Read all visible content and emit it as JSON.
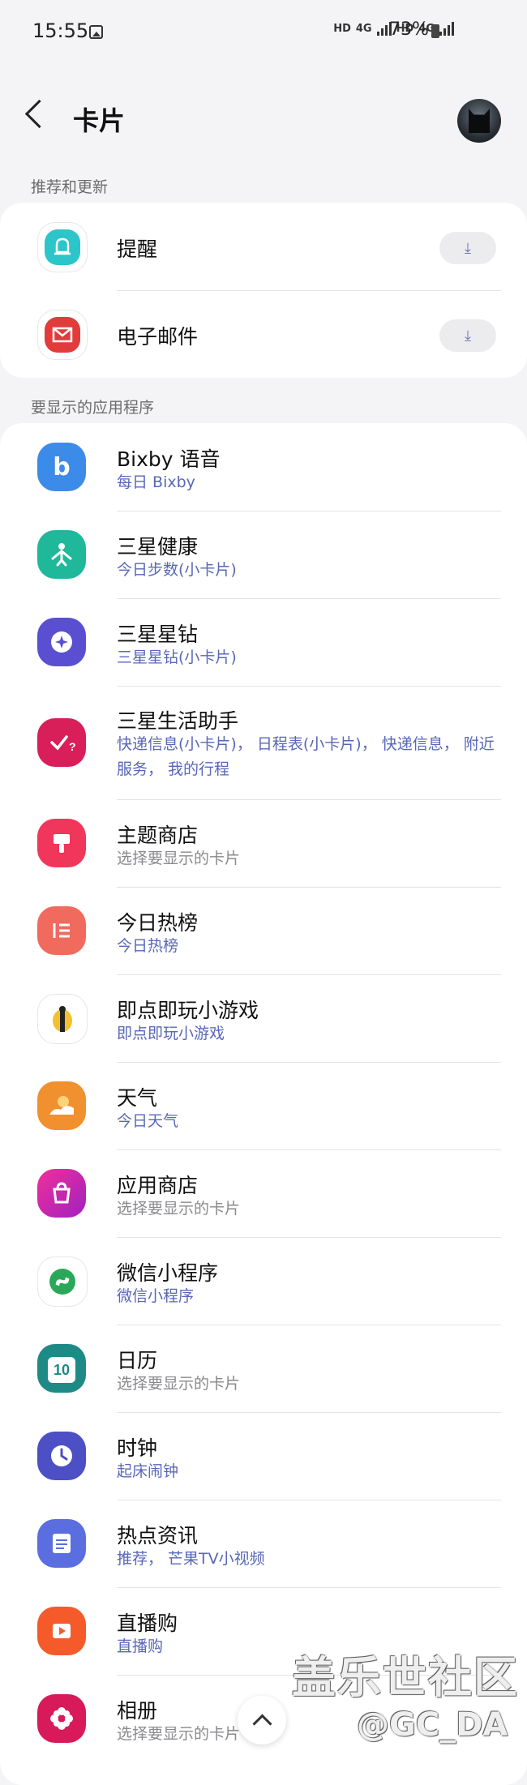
{
  "status_bar": {
    "time": "15:55",
    "net1": "HD",
    "net2": "4G",
    "net3": "HD",
    "net4": "4G",
    "battery": "73%"
  },
  "header": {
    "title": "卡片"
  },
  "recommended": {
    "label": "推荐和更新",
    "items": [
      {
        "name": "提醒",
        "icon": "reminder-bell-icon",
        "color": "#2cc5c9"
      },
      {
        "name": "电子邮件",
        "icon": "mail-icon",
        "color": "#e23b3b"
      }
    ]
  },
  "apps": {
    "label": "要显示的应用程序",
    "items": [
      {
        "name": "Bixby 语音",
        "sub": "每日 Bixby",
        "icon": "bixby-icon",
        "color": "#3d8be8",
        "sub_grey": false
      },
      {
        "name": "三星健康",
        "sub": "今日步数(小卡片)",
        "icon": "samsung-health-icon",
        "color": "#1fb89a",
        "sub_grey": false
      },
      {
        "name": "三星星钻",
        "sub": "三星星钻(小卡片)",
        "icon": "samsung-rewards-icon",
        "color": "#5a4fd0",
        "sub_grey": false
      },
      {
        "name": "三星生活助手",
        "sub": "快递信息(小卡片)， 日程表(小卡片)， 快递信息， 附近服务， 我的行程",
        "icon": "life-assistant-icon",
        "color": "#d81f5a",
        "sub_grey": false
      },
      {
        "name": "主题商店",
        "sub": "选择要显示的卡片",
        "icon": "theme-store-icon",
        "color": "#f0365a",
        "sub_grey": true
      },
      {
        "name": "今日热榜",
        "sub": "今日热榜",
        "icon": "hot-list-icon",
        "color": "#f06a5e",
        "sub_grey": false
      },
      {
        "name": "即点即玩小游戏",
        "sub": "即点即玩小游戏",
        "icon": "mini-game-icon",
        "color": "#f4c030",
        "sub_grey": false
      },
      {
        "name": "天气",
        "sub": "今日天气",
        "icon": "weather-icon",
        "color": "#f0902e",
        "sub_grey": false
      },
      {
        "name": "应用商店",
        "sub": "选择要显示的卡片",
        "icon": "app-store-icon",
        "color": "#d92aa8",
        "sub_grey": true
      },
      {
        "name": "微信小程序",
        "sub": "微信小程序",
        "icon": "wechat-miniprogram-icon",
        "color": "#2aa85a",
        "sub_grey": false
      },
      {
        "name": "日历",
        "sub": "选择要显示的卡片",
        "icon": "calendar-icon",
        "color": "#1d8a86",
        "sub_grey": true
      },
      {
        "name": "时钟",
        "sub": "起床闹钟",
        "icon": "clock-icon",
        "color": "#4d4fc4",
        "sub_grey": false
      },
      {
        "name": "热点资讯",
        "sub": "推荐， 芒果TV小视频",
        "icon": "news-icon",
        "color": "#5a6ee0",
        "sub_grey": false
      },
      {
        "name": "直播购",
        "sub": "直播购",
        "icon": "live-shop-icon",
        "color": "#f55a2a",
        "sub_grey": false
      },
      {
        "name": "相册",
        "sub": "选择要显示的卡片",
        "icon": "gallery-icon",
        "color": "#d81a5a",
        "sub_grey": true
      }
    ]
  },
  "icons": {
    "calendar_day": "10",
    "download_glyph": "⤓"
  },
  "watermark": {
    "line1": "盖乐世社区",
    "line2": "@GC_DA"
  }
}
